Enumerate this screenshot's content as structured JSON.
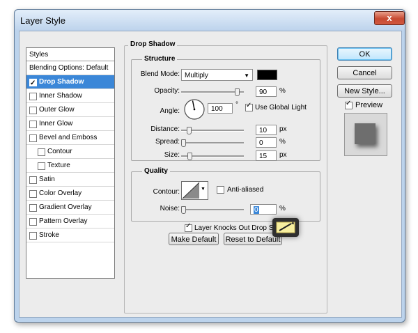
{
  "window": {
    "title": "Layer Style",
    "close_glyph": "x"
  },
  "styles_list": {
    "header": "Styles",
    "items": [
      {
        "label": "Blending Options: Default",
        "checkbox": false,
        "checked": false,
        "selected": false,
        "indent": false
      },
      {
        "label": "Drop Shadow",
        "checkbox": true,
        "checked": true,
        "selected": true,
        "indent": false
      },
      {
        "label": "Inner Shadow",
        "checkbox": true,
        "checked": false,
        "selected": false,
        "indent": false
      },
      {
        "label": "Outer Glow",
        "checkbox": true,
        "checked": false,
        "selected": false,
        "indent": false
      },
      {
        "label": "Inner Glow",
        "checkbox": true,
        "checked": false,
        "selected": false,
        "indent": false
      },
      {
        "label": "Bevel and Emboss",
        "checkbox": true,
        "checked": false,
        "selected": false,
        "indent": false
      },
      {
        "label": "Contour",
        "checkbox": true,
        "checked": false,
        "selected": false,
        "indent": true
      },
      {
        "label": "Texture",
        "checkbox": true,
        "checked": false,
        "selected": false,
        "indent": true
      },
      {
        "label": "Satin",
        "checkbox": true,
        "checked": false,
        "selected": false,
        "indent": false
      },
      {
        "label": "Color Overlay",
        "checkbox": true,
        "checked": false,
        "selected": false,
        "indent": false
      },
      {
        "label": "Gradient Overlay",
        "checkbox": true,
        "checked": false,
        "selected": false,
        "indent": false
      },
      {
        "label": "Pattern Overlay",
        "checkbox": true,
        "checked": false,
        "selected": false,
        "indent": false
      },
      {
        "label": "Stroke",
        "checkbox": true,
        "checked": false,
        "selected": false,
        "indent": false
      }
    ]
  },
  "drop_shadow": {
    "title": "Drop Shadow",
    "structure": {
      "title": "Structure",
      "blend_mode_label": "Blend Mode:",
      "blend_mode_value": "Multiply",
      "shadow_color": "#000000",
      "opacity_label": "Opacity:",
      "opacity_value": "90",
      "opacity_level": 0.9,
      "opacity_unit": "%",
      "angle_label": "Angle:",
      "angle_value": "100",
      "angle_unit": "°",
      "use_global_light_label": "Use Global Light",
      "use_global_light": true,
      "distance_label": "Distance:",
      "distance_value": "10",
      "distance_unit": "px",
      "spread_label": "Spread:",
      "spread_value": "0",
      "spread_unit": "%",
      "size_label": "Size:",
      "size_value": "15",
      "size_unit": "px"
    },
    "quality": {
      "title": "Quality",
      "contour_label": "Contour:",
      "anti_aliased_label": "Anti-aliased",
      "anti_aliased": false,
      "noise_label": "Noise:",
      "noise_value": "0",
      "noise_unit": "%"
    },
    "knockout_label": "Layer Knocks Out Drop Shadow",
    "knockout_checked": true,
    "make_default_label": "Make Default",
    "reset_default_label": "Reset to Default"
  },
  "buttons": {
    "ok": "OK",
    "cancel": "Cancel",
    "new_style": "New Style...",
    "preview_label": "Preview",
    "preview_checked": true
  },
  "icons": [
    "close-icon",
    "dropdown-arrow-icon",
    "angle-dial-icon",
    "contour-curve-icon",
    "checkbox-check-icon",
    "pencil-marker-icon"
  ]
}
